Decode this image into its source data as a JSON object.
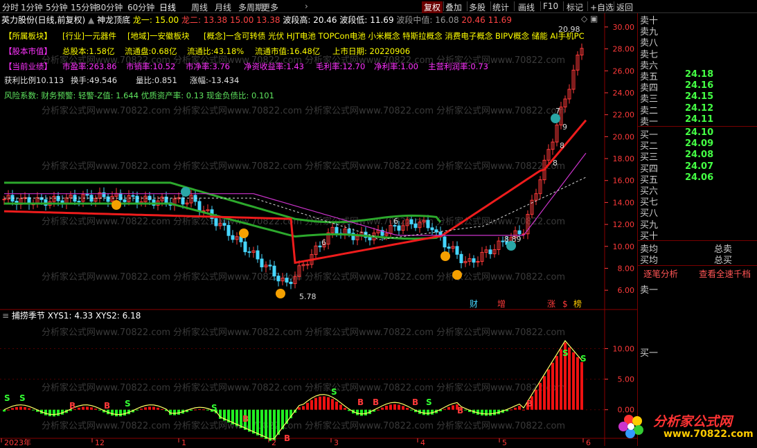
{
  "toolbar": {
    "periods": [
      "分时",
      "1分钟",
      "5分钟",
      "15分钟",
      "30分钟",
      "60分钟",
      "日线",
      "周线",
      "月线",
      "多周期",
      "更多"
    ],
    "more_arrow": "›",
    "right_buttons": [
      "复权",
      "叠加",
      "多股",
      "统计",
      "画线",
      "F10",
      "标记",
      "+自选",
      "返回"
    ]
  },
  "header": {
    "stock": "英力股份(日线,前复权)",
    "indicator": "神龙顶底",
    "values": [
      {
        "label": "龙一: 15.00",
        "color": "#ffff00"
      },
      {
        "label": "龙二: 13.38",
        "color": "#ff4444"
      },
      {
        "label": "15.00",
        "color": "#ff4444"
      },
      {
        "label": "13.38",
        "color": "#ff4444"
      },
      {
        "label": "波段高: 20.46",
        "color": "#ffffff"
      },
      {
        "label": "波段低: 11.69",
        "color": "#ffffff"
      },
      {
        "label": "波段中值: 16.08",
        "color": "#999999"
      },
      {
        "label": "20.46",
        "color": "#ff4444"
      },
      {
        "label": "11.69",
        "color": "#ff4444"
      }
    ]
  },
  "info_lines": [
    {
      "parts": [
        {
          "t": "【所属板块】",
          "cls": "y"
        },
        {
          "t": "[行业]一元器件",
          "cls": "y"
        },
        {
          "t": "[地域]一安徽板块",
          "cls": "y"
        },
        {
          "t": "[概念]一含可转债 光伏 HJT电池 TOPCon电池 小米概念 特斯拉概念 消费电子概念 BIPV概念 储能 AI手机PC",
          "cls": "y"
        }
      ]
    },
    {
      "parts": [
        {
          "t": "【股本市值】",
          "cls": "m"
        },
        {
          "t": "总股本:1.58亿",
          "cls": "y"
        },
        {
          "t": "流通盘:0.68亿",
          "cls": "y"
        },
        {
          "t": "流通比:43.18%",
          "cls": "y"
        },
        {
          "t": "流通市值:16.48亿",
          "cls": "y"
        },
        {
          "t": "上市日期: 20220906",
          "cls": "y"
        }
      ]
    },
    {
      "parts": [
        {
          "t": "【当前业绩】",
          "cls": "m"
        },
        {
          "t": "市盈率:263.86",
          "cls": "m"
        },
        {
          "t": "市销率:10.52",
          "cls": "m"
        },
        {
          "t": "市净率:3.76",
          "cls": "m"
        },
        {
          "t": "净资收益率:1.43",
          "cls": "m"
        },
        {
          "t": "毛利率:12.70",
          "cls": "m"
        },
        {
          "t": "净利率:1.00",
          "cls": "m"
        },
        {
          "t": "主营利润率:0.73",
          "cls": "m"
        }
      ]
    },
    {
      "parts": [
        {
          "t": "获利比例10.113",
          "cls": "w"
        },
        {
          "t": "换手:49.546",
          "cls": "w"
        },
        {
          "t": "量比:0.851",
          "cls": "w"
        },
        {
          "t": "涨幅:-13.434",
          "cls": "w"
        }
      ]
    },
    {
      "parts": [
        {
          "t": "风险系数: 财务预警: 轻警-Z值: 1.644 优质资产率: 0.13 现金负债比: 0.101",
          "cls": "gr"
        }
      ]
    }
  ],
  "watermark": "分析家公式网www.70822.com",
  "chart_data": [
    {
      "type": "line",
      "title": "英力股份(日线,前复权)",
      "ylim": [
        5,
        30.5
      ],
      "y_ticks": [
        "30.00",
        "28.00",
        "26.00",
        "24.00",
        "22.00",
        "20.00",
        "18.00",
        "16.00",
        "14.00",
        "12.00",
        "10.00",
        "8.00",
        "6.00"
      ],
      "annotations": [
        "20.98",
        "5.78",
        "8.89",
        "6",
        "7",
        "9",
        "6",
        "8",
        "8"
      ],
      "event_labels": [
        "财",
        "增",
        "涨",
        "$",
        "榜"
      ]
    },
    {
      "type": "bar",
      "title": "捕捞季节",
      "series_labels": [
        "XYS1: 4.33",
        "XYS2: 6.18"
      ],
      "ylim": [
        -4,
        13
      ],
      "y_ticks": [
        "10.00",
        "5.00",
        "0.00"
      ],
      "x_ticks": [
        "2023年",
        "12",
        "1",
        "2",
        "3",
        "4",
        "5",
        "6"
      ]
    }
  ],
  "order_book": {
    "asks": [
      {
        "label": "卖十",
        "price": ""
      },
      {
        "label": "卖九",
        "price": ""
      },
      {
        "label": "卖八",
        "price": ""
      },
      {
        "label": "卖七",
        "price": ""
      },
      {
        "label": "卖六",
        "price": ""
      },
      {
        "label": "卖五",
        "price": "24.18"
      },
      {
        "label": "卖四",
        "price": "24.16"
      },
      {
        "label": "卖三",
        "price": "24.15"
      },
      {
        "label": "卖二",
        "price": "24.12"
      },
      {
        "label": "卖一",
        "price": "24.11"
      }
    ],
    "bids": [
      {
        "label": "买一",
        "price": "24.10"
      },
      {
        "label": "买二",
        "price": "24.09"
      },
      {
        "label": "买三",
        "price": "24.08"
      },
      {
        "label": "买四",
        "price": "24.07"
      },
      {
        "label": "买五",
        "price": "24.06"
      },
      {
        "label": "买六",
        "price": ""
      },
      {
        "label": "买七",
        "price": ""
      },
      {
        "label": "买八",
        "price": ""
      },
      {
        "label": "买九",
        "price": ""
      },
      {
        "label": "买十",
        "price": ""
      }
    ],
    "sell_avg": "卖均",
    "buy_avg": "买均",
    "total_sell": "总卖",
    "total_buy": "总买",
    "tab_tick": "逐笔分析",
    "tab_all": "查看全速千档",
    "bottom1": "卖一",
    "bottom2": "买一"
  },
  "logo": {
    "name": "分析家公式网",
    "url": "www.70822.com"
  }
}
